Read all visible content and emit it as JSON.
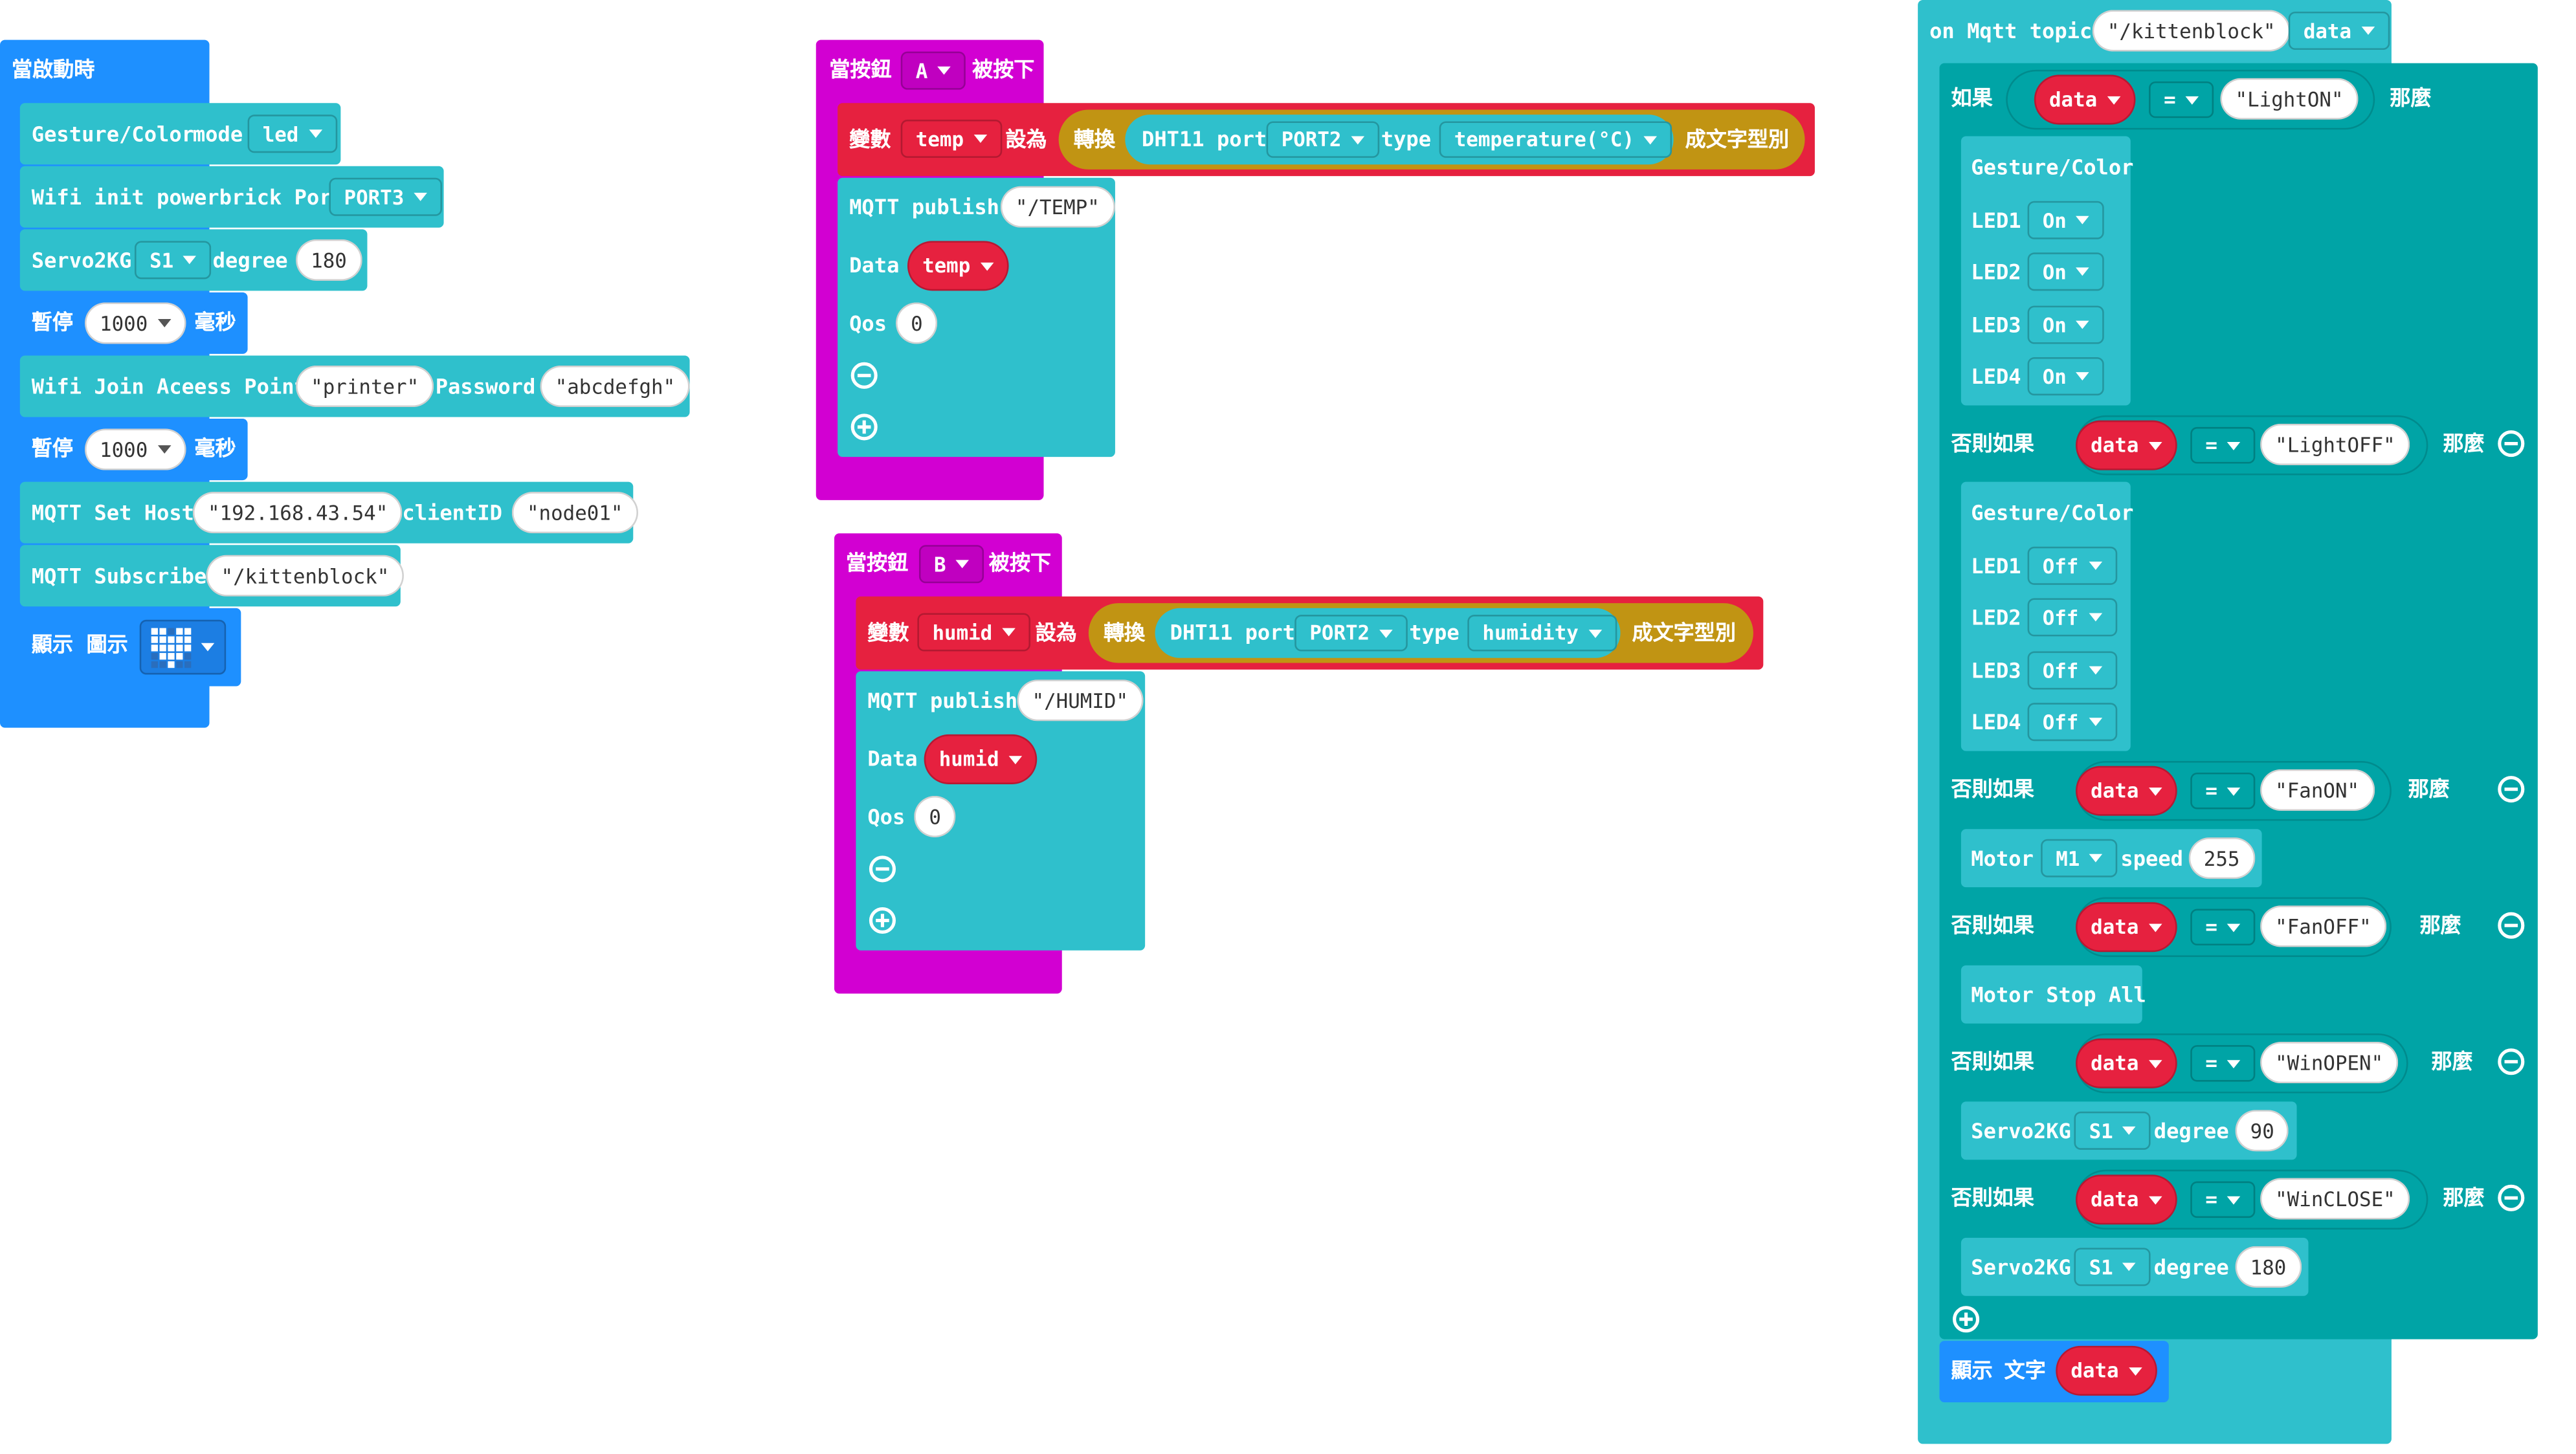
{
  "colors": {
    "basic": "#1e90ff",
    "powerbrick": "#2fc0cc",
    "input": "#d200d2",
    "variables": "#e6213f",
    "convert": "#c19413",
    "logic": "#00a4a6"
  },
  "on_start": {
    "hat": "當啟動時",
    "gesture": {
      "label": "Gesture/Color",
      "mode_label": "mode",
      "mode": "led"
    },
    "wifi_init": {
      "label": "Wifi init powerbrick Port",
      "port": "PORT3"
    },
    "servo": {
      "label": "Servo2KG",
      "servo": "S1",
      "degree_label": "degree",
      "degree": "180"
    },
    "pause1": {
      "label": "暫停",
      "value": "1000",
      "unit": "毫秒"
    },
    "wifi_join": {
      "label": "Wifi Join Aceess Point",
      "ssid": "printer",
      "pwd_label": "Password",
      "pwd": "abcdefgh"
    },
    "pause2": {
      "label": "暫停",
      "value": "1000",
      "unit": "毫秒"
    },
    "mqtt_host": {
      "label": "MQTT Set Host",
      "host": "192.168.43.54",
      "client_label": "clientID",
      "client": "node01"
    },
    "mqtt_sub": {
      "label": "MQTT Subscribe",
      "topic": "/kittenblock"
    },
    "show_icon": {
      "label1": "顯示",
      "label2": "圖示",
      "icon": "heart-icon"
    }
  },
  "button_a": {
    "hat_pre": "當按鈕",
    "button": "A",
    "hat_post": "被按下",
    "set": {
      "label": "變數",
      "var": "temp",
      "set_label": "設為",
      "convert": "轉換",
      "sensor": "DHT11 port",
      "port": "PORT2",
      "type_label": "type",
      "type": "temperature(°C)",
      "tail": "成文字型別"
    },
    "publish": {
      "label": "MQTT publish",
      "topic": "/TEMP",
      "data_label": "Data",
      "data": "temp",
      "qos_label": "Qos",
      "qos": "0"
    }
  },
  "button_b": {
    "hat_pre": "當按鈕",
    "button": "B",
    "hat_post": "被按下",
    "set": {
      "label": "變數",
      "var": "humid",
      "set_label": "設為",
      "convert": "轉換",
      "sensor": "DHT11 port",
      "port": "PORT2",
      "type_label": "type",
      "type": "humidity",
      "tail": "成文字型別"
    },
    "publish": {
      "label": "MQTT publish",
      "topic": "/HUMID",
      "data_label": "Data",
      "data": "humid",
      "qos_label": "Qos",
      "qos": "0"
    }
  },
  "mqtt_handler": {
    "hat_label": "on Mqtt topic",
    "topic": "/kittenblock",
    "var": "data",
    "if_label": "如果",
    "elif_label": "否則如果",
    "then_label": "那麼",
    "op": "=",
    "branches": [
      {
        "value": "LightON"
      },
      {
        "value": "LightOFF"
      },
      {
        "value": "FanON"
      },
      {
        "value": "FanOFF"
      },
      {
        "value": "WinOPEN"
      },
      {
        "value": "WinCLOSE"
      }
    ],
    "gesture_label": "Gesture/Color",
    "leds_on": [
      {
        "label": "LED1",
        "state": "On"
      },
      {
        "label": "LED2",
        "state": "On"
      },
      {
        "label": "LED3",
        "state": "On"
      },
      {
        "label": "LED4",
        "state": "On"
      }
    ],
    "leds_off": [
      {
        "label": "LED1",
        "state": "Off"
      },
      {
        "label": "LED2",
        "state": "Off"
      },
      {
        "label": "LED3",
        "state": "Off"
      },
      {
        "label": "LED4",
        "state": "Off"
      }
    ],
    "motor": {
      "label": "Motor",
      "motor": "M1",
      "speed_label": "speed",
      "speed": "255"
    },
    "motor_stop": "Motor Stop All",
    "servo_open": {
      "label": "Servo2KG",
      "servo": "S1",
      "degree_label": "degree",
      "degree": "90"
    },
    "servo_close": {
      "label": "Servo2KG",
      "servo": "S1",
      "degree_label": "degree",
      "degree": "180"
    },
    "show_text": {
      "label1": "顯示",
      "label2": "文字",
      "var": "data"
    }
  }
}
